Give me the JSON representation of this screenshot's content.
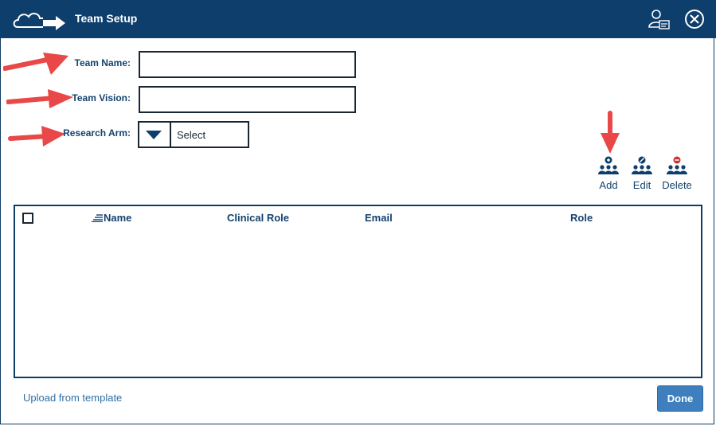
{
  "header": {
    "title": "Team Setup"
  },
  "form": {
    "team_name_label": "Team Name:",
    "team_name_value": "",
    "team_vision_label": "Team Vision:",
    "team_vision_value": "",
    "research_arm_label": "Research Arm:",
    "research_arm_value": "Select"
  },
  "actions": {
    "add": "Add",
    "edit": "Edit",
    "delete": "Delete"
  },
  "table": {
    "columns": [
      "Name",
      "Clinical Role",
      "Email",
      "Role"
    ],
    "rows": []
  },
  "footer": {
    "upload_link": "Upload from template",
    "done": "Done"
  },
  "colors": {
    "header_bg": "#0e3e6c",
    "label": "#13426e",
    "annotation_arrow": "#e84848",
    "done_bg": "#3f7fbe",
    "delete_badge": "#d32f2f"
  },
  "icons": {
    "logo": "cloud-arrow-icon",
    "user_card": "user-card-icon",
    "close": "close-circle-icon"
  }
}
